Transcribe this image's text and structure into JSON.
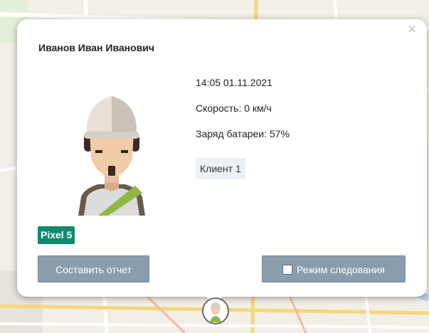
{
  "popup": {
    "close_label": "×",
    "user_name": "Иванов Иван Иванович",
    "datetime": "14:05 01.11.2021",
    "speed_label": "Скорость: 0 км/ч",
    "battery_label": "Заряд батареи: 57%",
    "client_label": "Клиент 1",
    "device_label": "Pixel 5",
    "report_button_label": "Составить отчет",
    "follow_button_label": "Режим следования"
  },
  "colors": {
    "device_badge": "#0e8a6f",
    "button_bg": "#8a9dac",
    "client_tag_bg": "#ecf1f5"
  }
}
